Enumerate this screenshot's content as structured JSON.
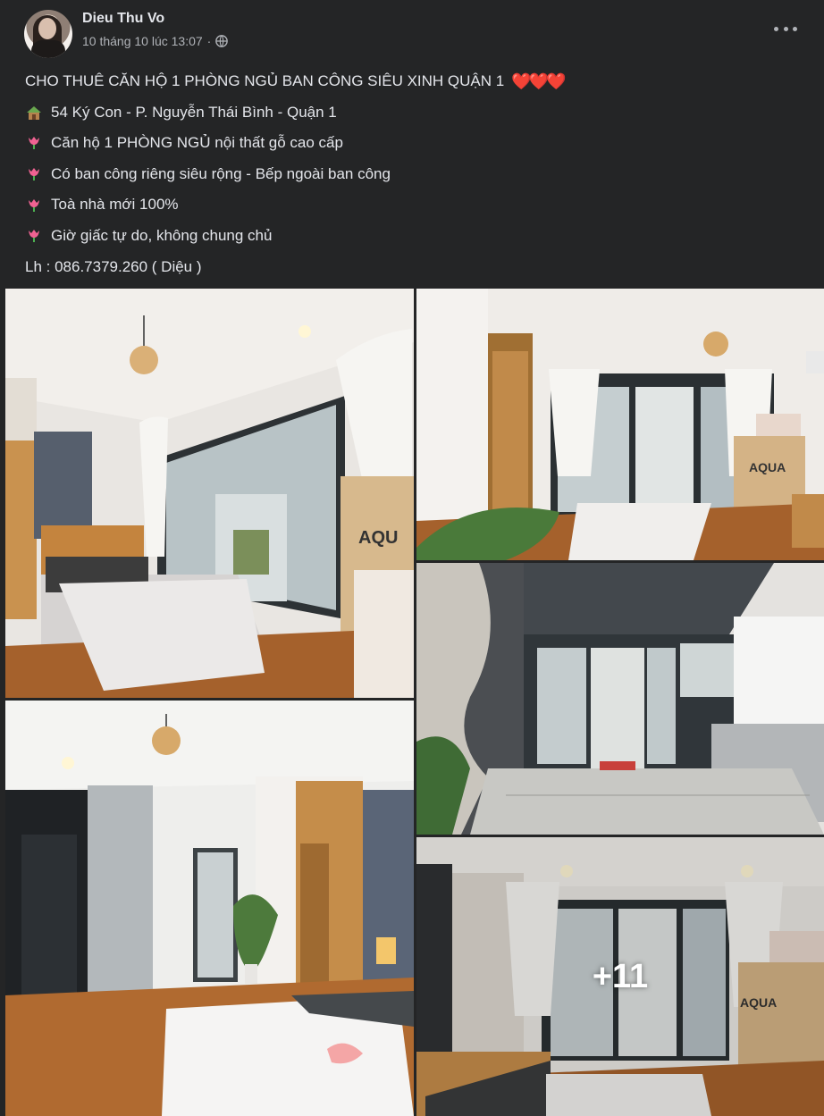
{
  "post": {
    "author": "Dieu Thu Vo",
    "timestamp": "10 tháng 10 lúc 13:07",
    "privacy_icon": "globe-icon",
    "more_icon": "more-options-icon"
  },
  "content": {
    "title": "CHO THUÊ CĂN HỘ 1 PHÒNG NGỦ BAN CÔNG SIÊU XINH QUẬN 1",
    "title_emoji": "❤️❤️❤️",
    "lines": [
      {
        "icon": "house-icon",
        "text": "54 Ký Con - P. Nguyễn Thái Bình - Quận 1"
      },
      {
        "icon": "tulip-icon",
        "text": "Căn hộ 1 PHÒNG NGỦ nội thất gỗ cao cấp"
      },
      {
        "icon": "tulip-icon",
        "text": "Có ban công riêng siêu rộng - Bếp ngoài ban công"
      },
      {
        "icon": "tulip-icon",
        "text": "Toà nhà mới 100%"
      },
      {
        "icon": "tulip-icon",
        "text": "Giờ giấc tự do, không chung chủ"
      }
    ],
    "contact": "Lh : 086.7379.260 ( Diệu )"
  },
  "photos": {
    "more_count": "+11",
    "items": [
      {
        "name": "photo-bedroom-balcony"
      },
      {
        "name": "photo-bedroom-window"
      },
      {
        "name": "photo-balcony-kitchen"
      },
      {
        "name": "photo-bedroom-door"
      },
      {
        "name": "photo-bedroom-more"
      }
    ]
  },
  "colors": {
    "background": "#242526",
    "text": "#e4e6eb",
    "secondary": "#b0b3b8",
    "heart": "#e53935"
  }
}
